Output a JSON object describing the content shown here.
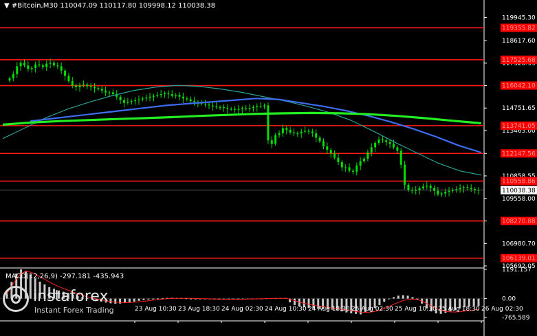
{
  "header": {
    "symbol": "#Bitcoin,M30",
    "ohlc": "110047.09 110117.80 109998.12 110038.38"
  },
  "indicator": {
    "label": "MACD(12,26,9) -297.181 -435.943"
  },
  "watermark": {
    "name": "instaforex",
    "sub": "Instant Forex Trading"
  },
  "colors": {
    "background": "#000000",
    "candles": "#00e000",
    "level_lines": "#ff1a1a",
    "level_label_bg": "#ff0000",
    "ma_fast": "#2aa198",
    "ma_mid": "#3d6df0",
    "ma_slow": "#22ee22",
    "macd_hist": "#c8c8c8",
    "macd_signal": "#ff2020",
    "axis_text": "#ffffff",
    "grid": "#333333"
  },
  "chart_data": {
    "type": "candlestick",
    "ylim": [
      105692.05,
      120400
    ],
    "price_axis_ticks": [
      119945.3,
      118617.6,
      117328.95,
      116042.1,
      114751.65,
      113463.0,
      112147.56,
      110858.55,
      109558.0,
      108270.88,
      106980.7,
      105692.05
    ],
    "current_price": 110038.38,
    "levels": [
      {
        "label": "119355.82",
        "value": 119355.82
      },
      {
        "label": "117525.68",
        "value": 117525.68
      },
      {
        "label": "116042.10",
        "value": 116042.1
      },
      {
        "label": "113741.05",
        "value": 113741.05
      },
      {
        "label": "112147.56",
        "value": 112147.56
      },
      {
        "label": "110558.86",
        "value": 110558.86
      },
      {
        "label": "108270.88",
        "value": 108270.88
      },
      {
        "label": "106139.01",
        "value": 106139.01
      }
    ],
    "time_labels": [
      "23 Aug 10:30",
      "23 Aug 18:30",
      "24 Aug 02:30",
      "24 Aug 10:30",
      "24 Aug 18:30",
      "25 Aug 02:30",
      "25 Aug 10:30",
      "25 Aug 18:30",
      "26 Aug 02:30"
    ],
    "closes": [
      116450,
      116700,
      117150,
      117350,
      117200,
      117000,
      117050,
      117250,
      117200,
      117100,
      117300,
      117350,
      117200,
      117150,
      116900,
      116600,
      116300,
      116050,
      115950,
      116050,
      116100,
      116000,
      115950,
      115900,
      115850,
      115750,
      115650,
      115650,
      115550,
      115400,
      115200,
      115050,
      115100,
      115150,
      115200,
      115250,
      115300,
      115350,
      115400,
      115450,
      115500,
      115550,
      115600,
      115550,
      115450,
      115500,
      115400,
      115300,
      115250,
      115150,
      115100,
      115050,
      115000,
      114950,
      114900,
      114850,
      114800,
      114800,
      114750,
      114700,
      114700,
      114650,
      114700,
      114750,
      114700,
      114750,
      114800,
      114850,
      114850,
      114900,
      112900,
      112700,
      113200,
      113300,
      113600,
      113500,
      113350,
      113300,
      113300,
      113400,
      113450,
      113400,
      113300,
      113050,
      112850,
      112550,
      112350,
      112150,
      111900,
      111650,
      111350,
      111350,
      111150,
      111100,
      111450,
      111700,
      111850,
      112200,
      112500,
      112750,
      112950,
      112900,
      112800,
      112700,
      112500,
      112300,
      111500,
      110350,
      110050,
      110000,
      110050,
      110150,
      110250,
      110300,
      110150,
      110000,
      109800,
      109850,
      109950,
      110000,
      110050,
      110100,
      110150,
      110200,
      110150,
      110100,
      110050,
      110038
    ],
    "ma_fast": [
      113000,
      113600,
      114200,
      114700,
      115100,
      115450,
      115750,
      115950,
      116050,
      116000,
      115850,
      115650,
      115400,
      115150,
      114850,
      114500,
      114050,
      113450,
      112800,
      112200,
      111600,
      111150,
      110900
    ],
    "ma_mid": [
      114000,
      114150,
      114300,
      114450,
      114600,
      114750,
      114900,
      115000,
      115100,
      115200,
      115300,
      115250,
      115050,
      114850,
      114600,
      114300,
      113950,
      113550,
      113100,
      112600,
      112200
    ],
    "ma_slow": [
      113800,
      113920,
      114000,
      114060,
      114120,
      114170,
      114230,
      114300,
      114360,
      114420,
      114450,
      114470,
      114450,
      114400,
      114300,
      114170,
      114020,
      113880
    ],
    "macd": {
      "ylim": [
        -765.589,
        1191.157
      ],
      "ticks": [
        1191.157,
        0.0,
        -765.589
      ],
      "histogram": [
        320,
        680,
        1020,
        1190,
        1130,
        980,
        820,
        690,
        580,
        470,
        400,
        330,
        280,
        230,
        170,
        110,
        60,
        20,
        -30,
        -70,
        -120,
        -160,
        -190,
        -205,
        -200,
        -180,
        -150,
        -120,
        -90,
        -60,
        -35,
        -15,
        5,
        20,
        30,
        35,
        30,
        20,
        10,
        0,
        -10,
        -20,
        -25,
        -30,
        -35,
        -40,
        -42,
        -40,
        -35,
        -28,
        -20,
        -12,
        -5,
        0,
        5,
        10,
        15,
        20,
        25,
        30,
        -150,
        -260,
        -320,
        -350,
        -380,
        -400,
        -410,
        -420,
        -440,
        -450,
        -480,
        -520,
        -560,
        -600,
        -620,
        -640,
        -560,
        -480,
        -380,
        -260,
        -130,
        -20,
        60,
        120,
        140,
        120,
        60,
        -40,
        -200,
        -400,
        -520,
        -600,
        -620,
        -580,
        -520,
        -460,
        -400,
        -350,
        -320,
        -300,
        -297
      ],
      "signal": [
        200,
        500,
        800,
        1020,
        1100,
        1080,
        1000,
        900,
        790,
        680,
        580,
        490,
        410,
        340,
        270,
        200,
        135,
        80,
        30,
        -10,
        -50,
        -90,
        -120,
        -145,
        -160,
        -165,
        -160,
        -150,
        -130,
        -110,
        -85,
        -60,
        -40,
        -20,
        -5,
        5,
        12,
        15,
        14,
        10,
        5,
        0,
        -5,
        -10,
        -15,
        -20,
        -24,
        -27,
        -28,
        -27,
        -24,
        -20,
        -15,
        -10,
        -5,
        0,
        4,
        8,
        12,
        15,
        -20,
        -80,
        -140,
        -190,
        -230,
        -270,
        -300,
        -330,
        -355,
        -380,
        -405,
        -430,
        -460,
        -490,
        -520,
        -550,
        -560,
        -550,
        -520,
        -470,
        -400,
        -320,
        -230,
        -150,
        -80,
        -40,
        -20,
        -40,
        -100,
        -200,
        -300,
        -400,
        -470,
        -520,
        -540,
        -545,
        -530,
        -510,
        -485,
        -460,
        -436
      ]
    }
  }
}
